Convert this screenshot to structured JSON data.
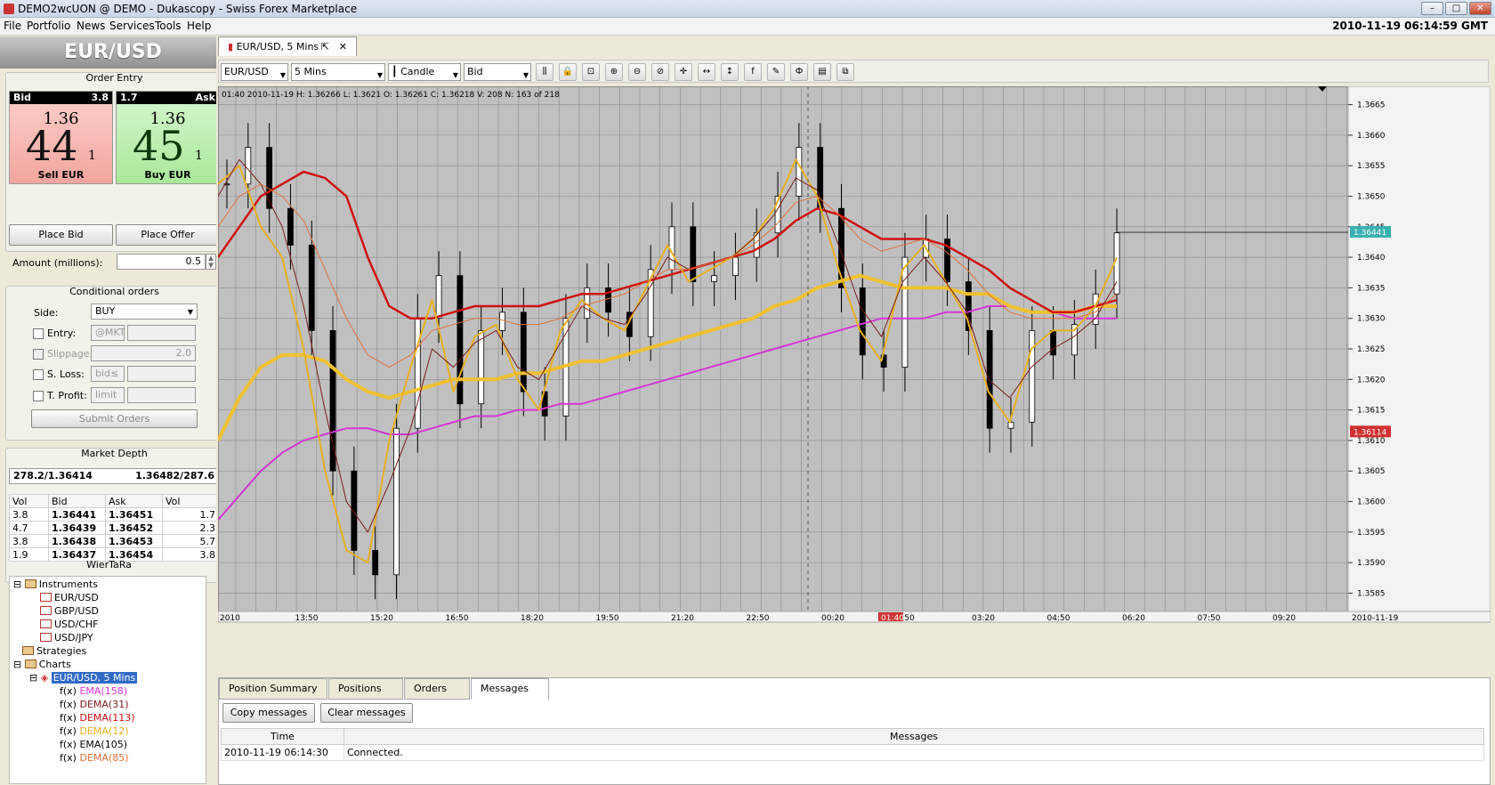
{
  "window": {
    "title": "DEMO2wcUON @ DEMO - Dukascopy - Swiss Forex Marketplace",
    "controls": [
      "–",
      "□",
      "✕"
    ]
  },
  "menu": [
    "File",
    "Portfolio",
    "News",
    "Services",
    "Tools",
    "Help"
  ],
  "clock": "2010-11-19 06:14:59 GMT",
  "left": {
    "pair": "EUR/USD",
    "order_entry": {
      "title": "Order Entry",
      "bid": {
        "label": "Bid",
        "volume": "3.8",
        "prefix": "1.36",
        "big": "44",
        "sub": "1",
        "action": "Sell EUR"
      },
      "ask": {
        "label": "Ask",
        "volume": "1.7",
        "prefix": "1.36",
        "big": "45",
        "sub": "1",
        "action": "Buy EUR"
      },
      "place_bid": "Place Bid",
      "place_offer": "Place Offer",
      "amount_label": "Amount (millions):",
      "amount_value": "0.5"
    },
    "conditional": {
      "title": "Conditional orders",
      "side_label": "Side:",
      "side_value": "BUY",
      "entry_label": "Entry:",
      "entry_value": "@MKT",
      "slippage_label": "Slippage:",
      "slippage_value": "2.0",
      "sloss_label": "S. Loss:",
      "sloss_value": "bid≤",
      "tprofit_label": "T. Profit:",
      "tprofit_value": "limit",
      "submit": "Submit Orders"
    },
    "depth": {
      "title": "Market Depth",
      "summary_left": "278.2/1.36414",
      "summary_right": "1.36482/287.6",
      "headers": [
        "Vol",
        "Bid",
        "Ask",
        "Vol"
      ],
      "rows": [
        [
          "3.8",
          "1.36441",
          "1.36451",
          "1.7"
        ],
        [
          "4.7",
          "1.36439",
          "1.36452",
          "2.3"
        ],
        [
          "3.8",
          "1.36438",
          "1.36453",
          "5.7"
        ],
        [
          "1.9",
          "1.36437",
          "1.36454",
          "3.8"
        ]
      ]
    },
    "tree": {
      "title": "WierTaRa",
      "instruments": "Instruments",
      "pairs": [
        "EUR/USD",
        "GBP/USD",
        "USD/CHF",
        "USD/JPY"
      ],
      "strategies": "Strategies",
      "charts": "Charts",
      "chart_name": "EUR/USD, 5 Mins",
      "indicators": [
        {
          "name": "EMA(158)",
          "color": "#d535d5"
        },
        {
          "name": "DEMA(31)",
          "color": "#7a1a1a"
        },
        {
          "name": "DEMA(113)",
          "color": "#d01010"
        },
        {
          "name": "DEMA(12)",
          "color": "#e8b020"
        },
        {
          "name": "EMA(105)",
          "color": "#000000"
        },
        {
          "name": "DEMA(85)",
          "color": "#e0703a"
        }
      ]
    }
  },
  "chart": {
    "tab": "EUR/USD,  5 Mins",
    "toolbar": {
      "instrument": "EUR/USD",
      "period": "5 Mins",
      "type": "Candle",
      "side": "Bid"
    },
    "toolbar_icons": [
      "bar-type-icon",
      "lock-icon",
      "zoom-fit-icon",
      "zoom-in-icon",
      "zoom-out-icon",
      "zoom-reset-icon",
      "crosshair-icon",
      "pan-horizontal-icon",
      "pan-vertical-icon",
      "function-icon",
      "draw-icon",
      "fibonacci-icon",
      "template-icon",
      "copy-icon"
    ],
    "info": "01:40 2010-11-19 H: 1.36266 L: 1.3621 O: 1.36261 C: 1.36218 V: 208 N: 163 of 218",
    "y_ticks": [
      "1.3665",
      "1.3660",
      "1.3655",
      "1.3650",
      "1.3645",
      "1.3640",
      "1.3635",
      "1.3630",
      "1.3625",
      "1.3620",
      "1.3615",
      "1.3610",
      "1.3605",
      "1.3600",
      "1.3595",
      "1.3590",
      "1.3585"
    ],
    "x_ticks": [
      "2010",
      "13:50",
      "15:20",
      "16:50",
      "18:20",
      "19:50",
      "21:20",
      "22:50",
      "00:20",
      "1:50",
      "03:20",
      "04:50",
      "06:20",
      "07:50",
      "09:20",
      "2010-11-19"
    ],
    "x_marker": "01:40",
    "price_bid": "1.36441",
    "price_red": "1.36114"
  },
  "chart_data": {
    "type": "line",
    "title": "EUR/USD, 5 Mins",
    "ylim": [
      1.3582,
      1.3668
    ],
    "series": [
      {
        "name": "EMA(158)",
        "color": "#d535d5",
        "values": [
          1.3597,
          1.3601,
          1.3605,
          1.3608,
          1.361,
          1.3611,
          1.3612,
          1.3612,
          1.3611,
          1.3611,
          1.3612,
          1.3613,
          1.3614,
          1.3614,
          1.3615,
          1.3615,
          1.3616,
          1.3616,
          1.3617,
          1.3618,
          1.3619,
          1.362,
          1.3621,
          1.3622,
          1.3623,
          1.3624,
          1.3625,
          1.3626,
          1.3627,
          1.3628,
          1.3629,
          1.363,
          1.363,
          1.363,
          1.3631,
          1.3631,
          1.3632,
          1.3632,
          1.3631,
          1.3631,
          1.363,
          1.363,
          1.363
        ]
      },
      {
        "name": "EMA(105)",
        "color": "#f0c030",
        "values": [
          1.361,
          1.3617,
          1.3622,
          1.3624,
          1.3624,
          1.3623,
          1.362,
          1.3618,
          1.3617,
          1.3618,
          1.3619,
          1.362,
          1.362,
          1.362,
          1.3621,
          1.3621,
          1.3622,
          1.3623,
          1.3623,
          1.3624,
          1.3625,
          1.3626,
          1.3627,
          1.3628,
          1.3629,
          1.363,
          1.3632,
          1.3633,
          1.3635,
          1.3636,
          1.3637,
          1.3636,
          1.3635,
          1.3635,
          1.3635,
          1.3634,
          1.3634,
          1.3632,
          1.3631,
          1.3631,
          1.3631,
          1.3632,
          1.3632
        ]
      },
      {
        "name": "DEMA(113)",
        "color": "#d01010",
        "values": [
          1.364,
          1.3645,
          1.365,
          1.3652,
          1.3654,
          1.3653,
          1.365,
          1.364,
          1.3632,
          1.363,
          1.363,
          1.3631,
          1.3632,
          1.3632,
          1.3632,
          1.3632,
          1.3633,
          1.3634,
          1.3634,
          1.3635,
          1.3636,
          1.3637,
          1.3638,
          1.3639,
          1.364,
          1.3641,
          1.3643,
          1.3646,
          1.3648,
          1.3647,
          1.3645,
          1.3643,
          1.3643,
          1.3643,
          1.3642,
          1.364,
          1.3638,
          1.3635,
          1.3633,
          1.3631,
          1.3631,
          1.3632,
          1.3633
        ]
      },
      {
        "name": "DEMA(12)",
        "color": "#e8b020",
        "values": [
          1.3652,
          1.3655,
          1.3645,
          1.364,
          1.3625,
          1.3605,
          1.3592,
          1.359,
          1.361,
          1.3622,
          1.3633,
          1.3618,
          1.3627,
          1.3629,
          1.362,
          1.3615,
          1.3628,
          1.3633,
          1.363,
          1.3628,
          1.3635,
          1.3642,
          1.3636,
          1.3638,
          1.364,
          1.3643,
          1.3648,
          1.3656,
          1.365,
          1.3638,
          1.3628,
          1.3623,
          1.3638,
          1.3642,
          1.3636,
          1.363,
          1.3618,
          1.3613,
          1.3625,
          1.3628,
          1.3628,
          1.3632,
          1.364
        ]
      },
      {
        "name": "DEMA(31)",
        "color": "#7a1a1a",
        "values": [
          1.365,
          1.3656,
          1.3652,
          1.3645,
          1.3632,
          1.3615,
          1.36,
          1.3595,
          1.3603,
          1.3612,
          1.3625,
          1.3622,
          1.3626,
          1.3628,
          1.3622,
          1.362,
          1.3626,
          1.3632,
          1.363,
          1.3629,
          1.3634,
          1.364,
          1.3638,
          1.3639,
          1.364,
          1.3643,
          1.3647,
          1.3653,
          1.3651,
          1.3642,
          1.3632,
          1.3627,
          1.3636,
          1.364,
          1.3636,
          1.3631,
          1.362,
          1.3617,
          1.3622,
          1.3625,
          1.3627,
          1.363,
          1.3636
        ]
      },
      {
        "name": "DEMA(85)",
        "color": "#e0703a",
        "values": [
          1.3645,
          1.365,
          1.3652,
          1.365,
          1.3646,
          1.3638,
          1.363,
          1.3624,
          1.3622,
          1.3624,
          1.3628,
          1.3629,
          1.363,
          1.363,
          1.3629,
          1.3629,
          1.363,
          1.3632,
          1.3633,
          1.3634,
          1.3636,
          1.3638,
          1.3638,
          1.3639,
          1.364,
          1.3642,
          1.3645,
          1.3649,
          1.365,
          1.3647,
          1.3643,
          1.3641,
          1.3642,
          1.3643,
          1.3641,
          1.3638,
          1.3634,
          1.3631,
          1.363,
          1.363,
          1.363,
          1.3631,
          1.3634
        ]
      }
    ],
    "candles_close": [
      1.3652,
      1.3658,
      1.3648,
      1.3642,
      1.3628,
      1.3605,
      1.3592,
      1.3588,
      1.3612,
      1.363,
      1.3637,
      1.3616,
      1.3628,
      1.3631,
      1.3618,
      1.3614,
      1.363,
      1.3635,
      1.3631,
      1.3627,
      1.3638,
      1.3645,
      1.3636,
      1.3637,
      1.364,
      1.3644,
      1.365,
      1.3658,
      1.3648,
      1.3635,
      1.3624,
      1.3622,
      1.364,
      1.3643,
      1.3636,
      1.3628,
      1.3612,
      1.3613,
      1.3628,
      1.3624,
      1.3629,
      1.3634,
      1.3644
    ]
  },
  "bottom": {
    "tabs": [
      "Position Summary",
      "Positions",
      "Orders",
      "Messages"
    ],
    "copy": "Copy messages",
    "clear": "Clear messages",
    "headers": [
      "Time",
      "Messages"
    ],
    "rows": [
      [
        "2010-11-19 06:14:30",
        "Connected."
      ]
    ]
  }
}
